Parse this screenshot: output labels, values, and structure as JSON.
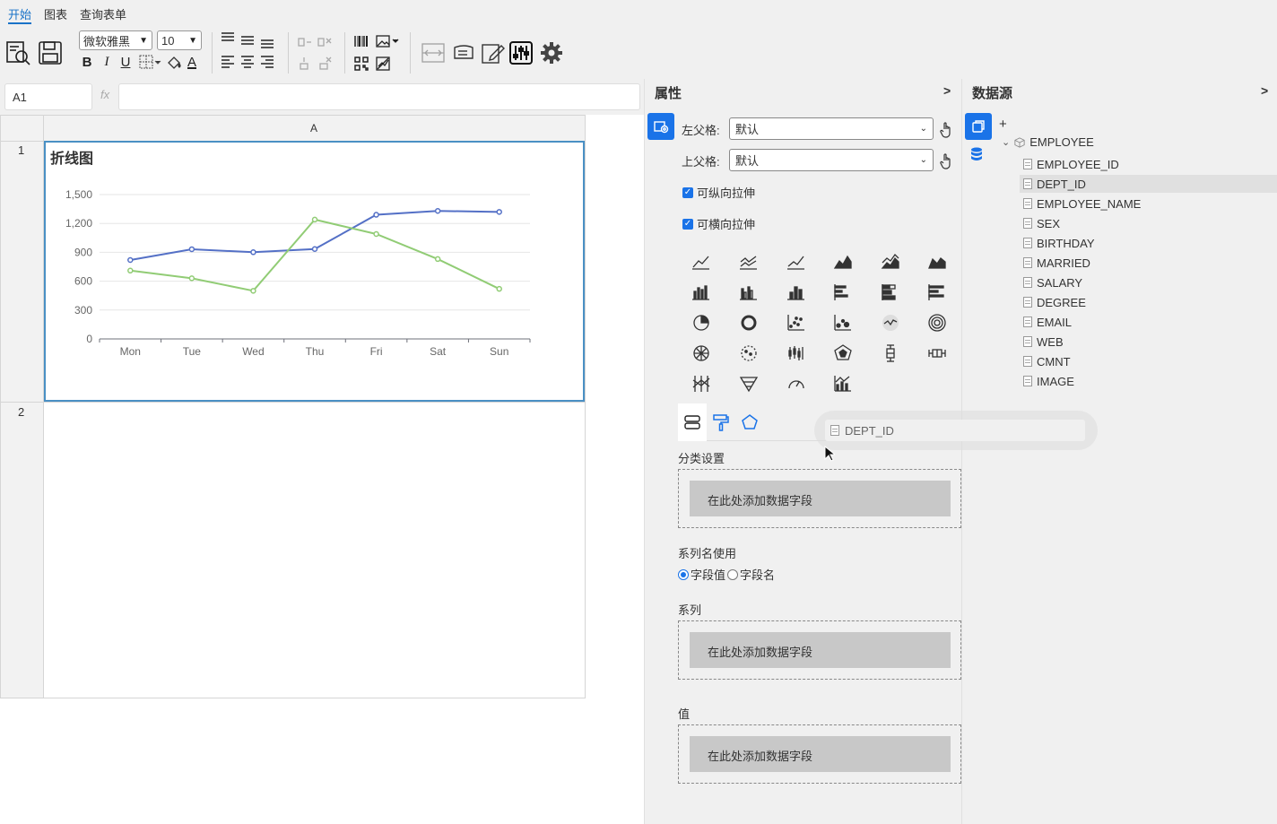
{
  "menu": {
    "tabs": [
      {
        "label": "开始"
      },
      {
        "label": "图表"
      },
      {
        "label": "查询表单"
      }
    ]
  },
  "toolbar": {
    "font_name": "微软雅黑",
    "font_size": "10"
  },
  "formula": {
    "cell_ref": "A1",
    "fx": "fx",
    "value": ""
  },
  "grid": {
    "col_a": "A",
    "row_1": "1",
    "row_2": "2"
  },
  "chart_title": "折线图",
  "chart_data": {
    "type": "line",
    "categories": [
      "Mon",
      "Tue",
      "Wed",
      "Thu",
      "Fri",
      "Sat",
      "Sun"
    ],
    "series": [
      {
        "color": "#5470c6",
        "values": [
          820,
          932,
          901,
          934,
          1290,
          1330,
          1320
        ]
      },
      {
        "color": "#91cc75",
        "values": [
          710,
          630,
          500,
          1240,
          1090,
          830,
          520
        ]
      }
    ],
    "ylim": [
      0,
      1500
    ],
    "yticks": [
      "0",
      "300",
      "600",
      "900",
      "1,200",
      "1,500"
    ],
    "grid": true
  },
  "properties": {
    "title": "属性",
    "collapse": ">",
    "left_parent_label": "左父格:",
    "left_parent_value": "默认",
    "top_parent_label": "上父格:",
    "top_parent_value": "默认",
    "stretch_v": "可纵向拉伸",
    "stretch_h": "可横向拉伸",
    "category_settings": "分类设置",
    "drop_hint": "在此处添加数据字段",
    "series_name_use": "系列名使用",
    "radio_field_value": "字段值",
    "radio_field_name": "字段名",
    "series": "系列",
    "value": "值"
  },
  "datasource": {
    "title": "数据源",
    "collapse": ">",
    "add": "+",
    "table": "EMPLOYEE",
    "fields": [
      "EMPLOYEE_ID",
      "DEPT_ID",
      "EMPLOYEE_NAME",
      "SEX",
      "BIRTHDAY",
      "MARRIED",
      "SALARY",
      "DEGREE",
      "EMAIL",
      "WEB",
      "CMNT",
      "IMAGE"
    ]
  },
  "drag_ghost": {
    "label": "DEPT_ID"
  }
}
